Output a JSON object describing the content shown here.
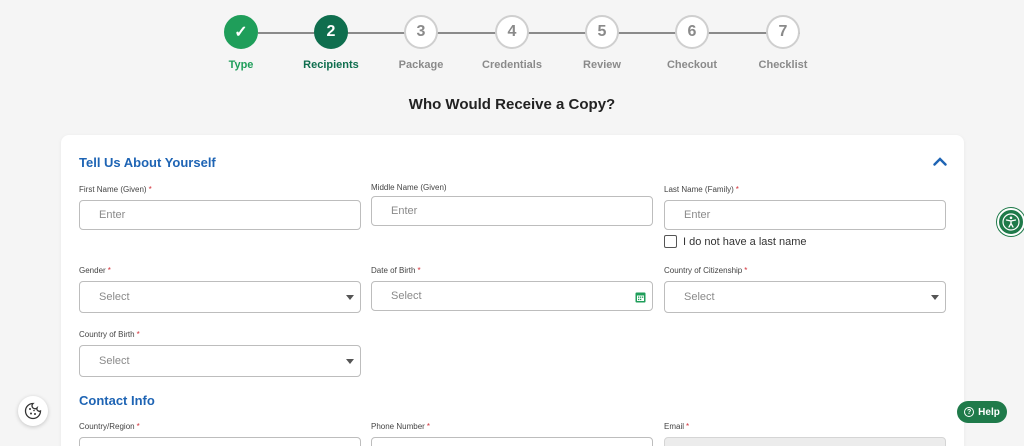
{
  "stepper": {
    "steps": [
      {
        "num": "✓",
        "label": "Type",
        "state": "done"
      },
      {
        "num": "2",
        "label": "Recipients",
        "state": "active"
      },
      {
        "num": "3",
        "label": "Package",
        "state": "pending"
      },
      {
        "num": "4",
        "label": "Credentials",
        "state": "pending"
      },
      {
        "num": "5",
        "label": "Review",
        "state": "pending"
      },
      {
        "num": "6",
        "label": "Checkout",
        "state": "pending"
      },
      {
        "num": "7",
        "label": "Checklist",
        "state": "pending"
      }
    ]
  },
  "page_title": "Who Would Receive a Copy?",
  "about": {
    "title": "Tell Us About Yourself",
    "first_name": {
      "label": "First Name (Given)",
      "placeholder": "Enter",
      "required": "*"
    },
    "middle_name": {
      "label": "Middle Name (Given)",
      "placeholder": "Enter"
    },
    "last_name": {
      "label": "Last Name (Family)",
      "placeholder": "Enter",
      "required": "*"
    },
    "no_last_name": "I do not have a last name",
    "gender": {
      "label": "Gender",
      "value": "Select",
      "required": "*"
    },
    "dob": {
      "label": "Date of Birth",
      "value": "Select",
      "required": "*"
    },
    "citizenship": {
      "label": "Country of Citizenship",
      "value": "Select",
      "required": "*"
    },
    "birth_country": {
      "label": "Country of Birth",
      "value": "Select",
      "required": "*"
    }
  },
  "contact": {
    "title": "Contact Info",
    "country_region": {
      "label": "Country/Region",
      "required": "*"
    },
    "phone": {
      "label": "Phone Number",
      "required": "*"
    },
    "email": {
      "label": "Email",
      "required": "*"
    }
  },
  "help": {
    "label": "Help"
  },
  "colors": {
    "primary_green": "#1f9e5a",
    "dark_green": "#0f6e4e",
    "link_blue": "#1e64b4",
    "required_red": "#d3323a"
  }
}
